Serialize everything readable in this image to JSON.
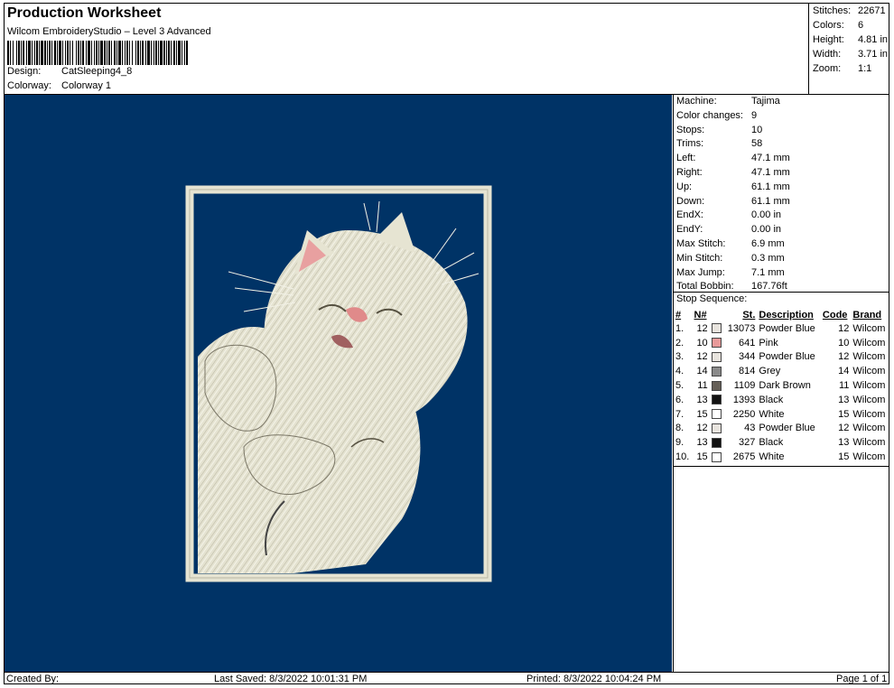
{
  "header": {
    "title": "Production Worksheet",
    "subtitle": "Wilcom EmbroideryStudio – Level 3 Advanced",
    "design_label": "Design:",
    "design_value": "CatSleeping4_8",
    "colorway_label": "Colorway:",
    "colorway_value": "Colorway 1"
  },
  "summary": {
    "stitches_label": "Stitches:",
    "stitches_value": "22671",
    "colors_label": "Colors:",
    "colors_value": "6",
    "height_label": "Height:",
    "height_value": "4.81 in",
    "width_label": "Width:",
    "width_value": "3.71 in",
    "zoom_label": "Zoom:",
    "zoom_value": "1:1"
  },
  "properties": [
    {
      "label": "Machine:",
      "value": "Tajima"
    },
    {
      "label": "Color changes:",
      "value": "9"
    },
    {
      "label": "Stops:",
      "value": "10"
    },
    {
      "label": "Trims:",
      "value": "58"
    },
    {
      "label": "Left:",
      "value": "47.1 mm"
    },
    {
      "label": "Right:",
      "value": "47.1 mm"
    },
    {
      "label": "Up:",
      "value": "61.1 mm"
    },
    {
      "label": "Down:",
      "value": "61.1 mm"
    },
    {
      "label": "EndX:",
      "value": "0.00 in"
    },
    {
      "label": "EndY:",
      "value": "0.00 in"
    },
    {
      "label": "Max Stitch:",
      "value": "6.9 mm"
    },
    {
      "label": "Min Stitch:",
      "value": "0.3 mm"
    },
    {
      "label": "Max Jump:",
      "value": "7.1 mm"
    },
    {
      "label": "Total Bobbin:",
      "value": "167.76ft"
    }
  ],
  "stop_sequence": {
    "title": "Stop Sequence:",
    "headers": {
      "num": "#",
      "n": "N#",
      "st": "St.",
      "description": "Description",
      "code": "Code",
      "brand": "Brand"
    },
    "rows": [
      {
        "num": "1.",
        "n": "12",
        "color": "#e8e4de",
        "st": "13073",
        "description": "Powder Blue",
        "code": "12",
        "brand": "Wilcom"
      },
      {
        "num": "2.",
        "n": "10",
        "color": "#e89a9a",
        "st": "641",
        "description": "Pink",
        "code": "10",
        "brand": "Wilcom"
      },
      {
        "num": "3.",
        "n": "12",
        "color": "#e8e4de",
        "st": "344",
        "description": "Powder Blue",
        "code": "12",
        "brand": "Wilcom"
      },
      {
        "num": "4.",
        "n": "14",
        "color": "#8a8a8a",
        "st": "814",
        "description": "Grey",
        "code": "14",
        "brand": "Wilcom"
      },
      {
        "num": "5.",
        "n": "11",
        "color": "#666058",
        "st": "1109",
        "description": "Dark Brown",
        "code": "11",
        "brand": "Wilcom"
      },
      {
        "num": "6.",
        "n": "13",
        "color": "#111111",
        "st": "1393",
        "description": "Black",
        "code": "13",
        "brand": "Wilcom"
      },
      {
        "num": "7.",
        "n": "15",
        "color": "#ffffff",
        "st": "2250",
        "description": "White",
        "code": "15",
        "brand": "Wilcom"
      },
      {
        "num": "8.",
        "n": "12",
        "color": "#e8e4de",
        "st": "43",
        "description": "Powder Blue",
        "code": "12",
        "brand": "Wilcom"
      },
      {
        "num": "9.",
        "n": "13",
        "color": "#111111",
        "st": "327",
        "description": "Black",
        "code": "13",
        "brand": "Wilcom"
      },
      {
        "num": "10.",
        "n": "15",
        "color": "#ffffff",
        "st": "2675",
        "description": "White",
        "code": "15",
        "brand": "Wilcom"
      }
    ]
  },
  "footer": {
    "created_by": "Created By:",
    "last_saved": "Last Saved: 8/3/2022 10:01:31 PM",
    "printed": "Printed: 8/3/2022 10:04:24 PM",
    "page": "Page 1 of 1"
  },
  "colors": {
    "background": "#003366",
    "thread_cream": "#e8e6d6",
    "thread_pink": "#e89a9a"
  }
}
